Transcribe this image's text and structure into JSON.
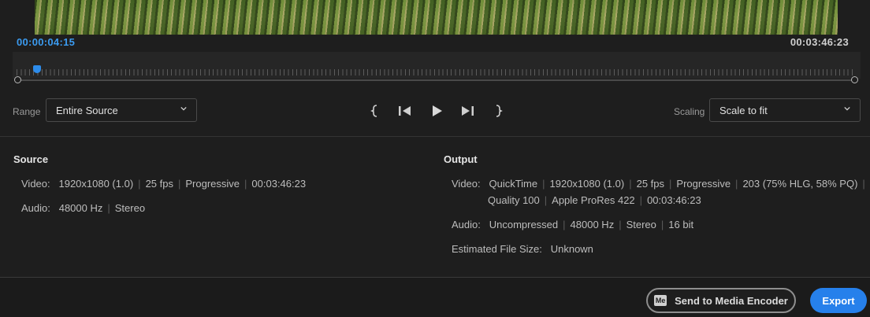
{
  "timeline": {
    "current_timecode": "00:00:04:15",
    "duration_timecode": "00:03:46:23",
    "playhead_position": 0.024
  },
  "range": {
    "label": "Range",
    "value": "Entire Source"
  },
  "scaling": {
    "label": "Scaling",
    "value": "Scale to fit"
  },
  "transport": {
    "set_in_icon": "mark-in-icon",
    "step_back_icon": "step-back-icon",
    "play_icon": "play-icon",
    "step_forward_icon": "step-forward-icon",
    "set_out_icon": "mark-out-icon"
  },
  "source": {
    "title": "Source",
    "video_label": "Video:",
    "video_parts": [
      "1920x1080 (1.0)",
      "25 fps",
      "Progressive",
      "00:03:46:23"
    ],
    "audio_label": "Audio:",
    "audio_parts": [
      "48000 Hz",
      "Stereo"
    ]
  },
  "output": {
    "title": "Output",
    "video_label": "Video:",
    "video_parts_line1": [
      "QuickTime",
      "1920x1080 (1.0)",
      "25 fps",
      "Progressive",
      "203 (75% HLG, 58% PQ)"
    ],
    "video_parts_line2": [
      "Quality 100",
      "Apple ProRes 422",
      "00:03:46:23"
    ],
    "audio_label": "Audio:",
    "audio_parts": [
      "Uncompressed",
      "48000 Hz",
      "Stereo",
      "16 bit"
    ],
    "filesize_label": "Estimated File Size:",
    "filesize_value": "Unknown"
  },
  "footer": {
    "media_encoder_badge": "Me",
    "send_label": "Send to Media Encoder",
    "export_label": "Export"
  },
  "colors": {
    "accent": "#2680eb",
    "timecode": "#3b9bf0"
  }
}
